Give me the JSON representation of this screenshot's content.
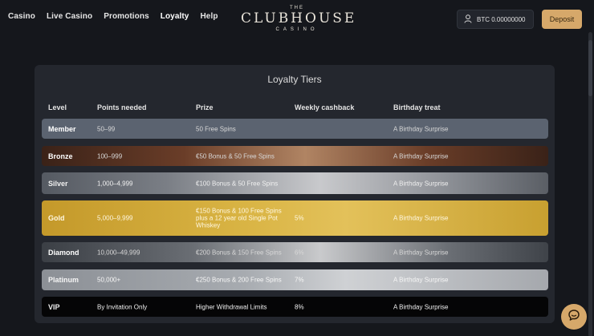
{
  "nav": {
    "items": [
      {
        "label": "Casino"
      },
      {
        "label": "Live Casino"
      },
      {
        "label": "Promotions"
      },
      {
        "label": "Loyalty"
      },
      {
        "label": "Help"
      }
    ]
  },
  "logo": {
    "top": "THE",
    "main": "CLUBHOUSE",
    "bottom": "CASINO"
  },
  "account": {
    "balance": "BTC 0.00000000",
    "deposit_label": "Deposit",
    "icon": "user-icon"
  },
  "table": {
    "title": "Loyalty Tiers",
    "headers": [
      "Level",
      "Points needed",
      "Prize",
      "Weekly cashback",
      "Birthday treat"
    ],
    "rows": [
      {
        "level": "Member",
        "points": "50–99",
        "prize": "50 Free Spins",
        "cashback": "",
        "birthday": "A Birthday Surprise"
      },
      {
        "level": "Bronze",
        "points": "100–999",
        "prize": "€50 Bonus & 50 Free Spins",
        "cashback": "",
        "birthday": "A Birthday Surprise"
      },
      {
        "level": "Silver",
        "points": "1,000–4,999",
        "prize": "€100 Bonus & 50 Free Spins",
        "cashback": "",
        "birthday": "A Birthday Surprise"
      },
      {
        "level": "Gold",
        "points": "5,000–9,999",
        "prize": "€150 Bonus & 100 Free Spins plus a 12 year old Single Pot Whiskey",
        "cashback": "5%",
        "birthday": "A Birthday Surprise"
      },
      {
        "level": "Diamond",
        "points": "10,000–49,999",
        "prize": "€200 Bonus & 150 Free Spins",
        "cashback": "6%",
        "birthday": "A Birthday Surprise"
      },
      {
        "level": "Platinum",
        "points": "50,000+",
        "prize": "€250 Bonus & 200 Free Spins",
        "cashback": "7%",
        "birthday": "A Birthday Surprise"
      },
      {
        "level": "VIP",
        "points": "By Invitation Only",
        "prize": "Higher Withdrawal Limits",
        "cashback": "8%",
        "birthday": "A Birthday Surprise"
      }
    ]
  },
  "chat": {
    "icon": "chat-icon"
  },
  "colors": {
    "accent": "#d6a86a",
    "background": "#15171c",
    "card": "#24272e"
  }
}
